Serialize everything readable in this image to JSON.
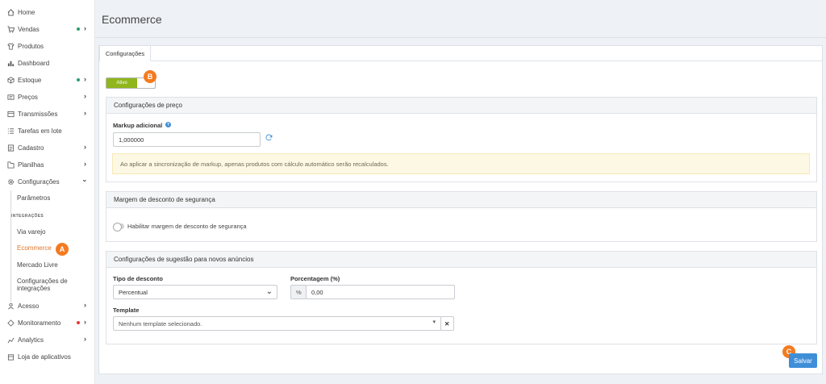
{
  "sidebar": {
    "items": [
      {
        "label": "Home",
        "icon": "home-icon"
      },
      {
        "label": "Vendas",
        "icon": "cart-icon",
        "dot": "#2e9e6b"
      },
      {
        "label": "Produtos",
        "icon": "shirt-icon"
      },
      {
        "label": "Dashboard",
        "icon": "bar-chart-icon"
      },
      {
        "label": "Estoque",
        "icon": "box-icon",
        "dot": "#2e9e6b"
      },
      {
        "label": "Preços",
        "icon": "price-tag-icon"
      },
      {
        "label": "Transmissões",
        "icon": "transmission-icon"
      },
      {
        "label": "Tarefas em lote",
        "icon": "list-icon"
      },
      {
        "label": "Cadastro",
        "icon": "form-icon"
      },
      {
        "label": "Planilhas",
        "icon": "spreadsheet-icon"
      },
      {
        "label": "Configurações",
        "icon": "gear-icon"
      },
      {
        "label": "Acesso",
        "icon": "users-icon"
      },
      {
        "label": "Monitoramento",
        "icon": "monitor-icon",
        "dot": "#e53935"
      },
      {
        "label": "Analytics",
        "icon": "analytics-icon"
      },
      {
        "label": "Loja de aplicativos",
        "icon": "store-icon"
      }
    ],
    "sub": {
      "parametros": "Parâmetros",
      "integracoes_caption": "INTEGRAÇÕES",
      "via_varejo": "Via varejo",
      "ecommerce": "Ecommerce",
      "mercado_livre": "Mercado Livre",
      "config_integracoes_1": "Configurações de",
      "config_integracoes_2": "integrações"
    },
    "badge_a": "A"
  },
  "page": {
    "title": "Ecommerce",
    "tab": "Configurações",
    "toggle_label": "Ativo",
    "badge_b": "B",
    "badge_c": "C",
    "accent": "#3f8fd8",
    "toggle_color": "#8fb61c",
    "badge_color": "#f47b20"
  },
  "preco": {
    "title": "Configurações de preço",
    "markup_label": "Markup adicional",
    "markup_value": "1,000000",
    "alert": "Ao aplicar a sincronização de markup, apenas produtos com cálculo automático serão recalculados."
  },
  "margem": {
    "title": "Margem de desconto de segurança",
    "switch_label": "Habilitar margem de desconto de segurança"
  },
  "sugestao": {
    "title": "Configurações de sugestão para novos anúncios",
    "tipo_label": "Tipo de desconto",
    "tipo_value": "Percentual",
    "porcentagem_label": "Porcentagem (%)",
    "porcentagem_prefix": "%",
    "porcentagem_value": "0,00",
    "template_label": "Template",
    "template_value": "Nenhum template selecionado."
  },
  "actions": {
    "save": "Salvar"
  }
}
